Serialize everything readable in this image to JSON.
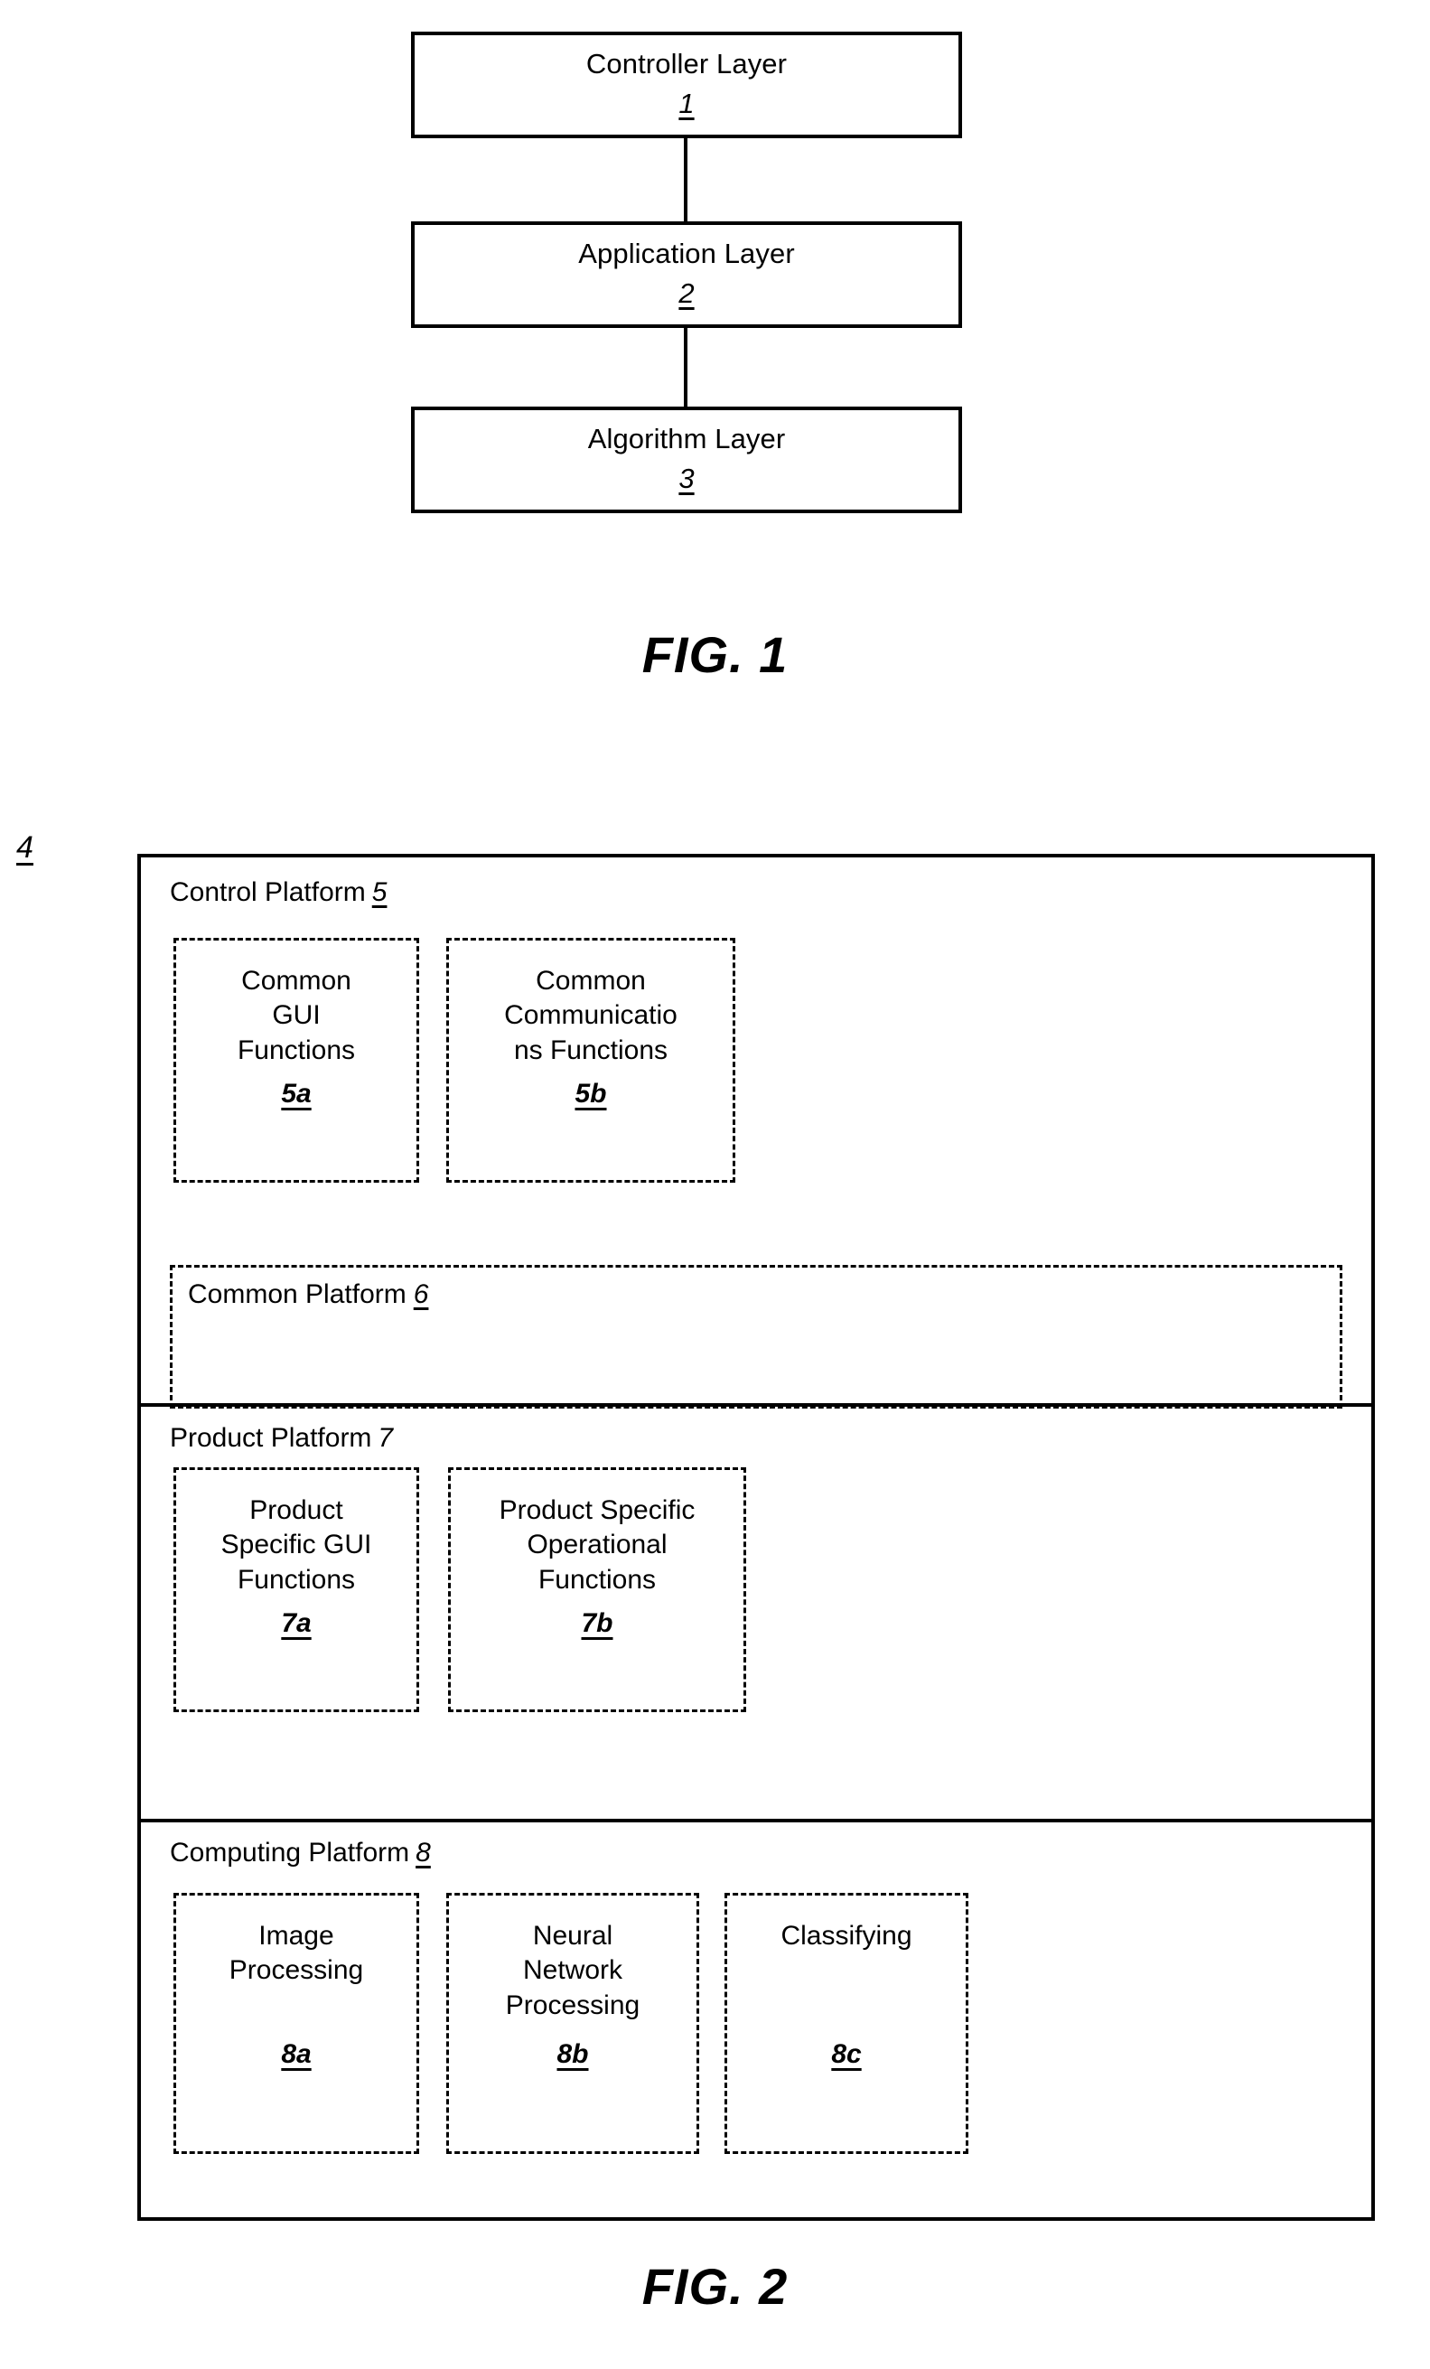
{
  "figure1": {
    "caption": "FIG. 1",
    "boxes": [
      {
        "label": "Controller Layer",
        "ref": "1"
      },
      {
        "label": "Application Layer",
        "ref": "2"
      },
      {
        "label": "Algorithm Layer",
        "ref": "3"
      }
    ]
  },
  "figure2": {
    "caption": "FIG. 2",
    "system_ref": "4",
    "sections": [
      {
        "title": "Control Platform",
        "ref": "5",
        "boxes": [
          {
            "lines": [
              "Common",
              "GUI",
              "Functions"
            ],
            "ref": "5a"
          },
          {
            "lines": [
              "Common",
              "Communicatio",
              "ns Functions"
            ],
            "ref": "5b"
          }
        ]
      },
      {
        "title": "Product Platform",
        "ref": "7",
        "boxes": [
          {
            "lines": [
              "Product",
              "Specific GUI",
              "Functions"
            ],
            "ref": "7a"
          },
          {
            "lines": [
              "Product Specific",
              "Operational",
              "Functions"
            ],
            "ref": "7b"
          }
        ]
      },
      {
        "title": "Computing Platform",
        "ref": "8",
        "boxes": [
          {
            "lines": [
              "Image",
              "Processing"
            ],
            "ref": "8a"
          },
          {
            "lines": [
              "Neural",
              "Network",
              "Processing"
            ],
            "ref": "8b"
          },
          {
            "lines": [
              "Classifying"
            ],
            "ref": "8c"
          }
        ]
      }
    ],
    "common_platform": {
      "title": "Common Platform",
      "ref": "6"
    }
  }
}
